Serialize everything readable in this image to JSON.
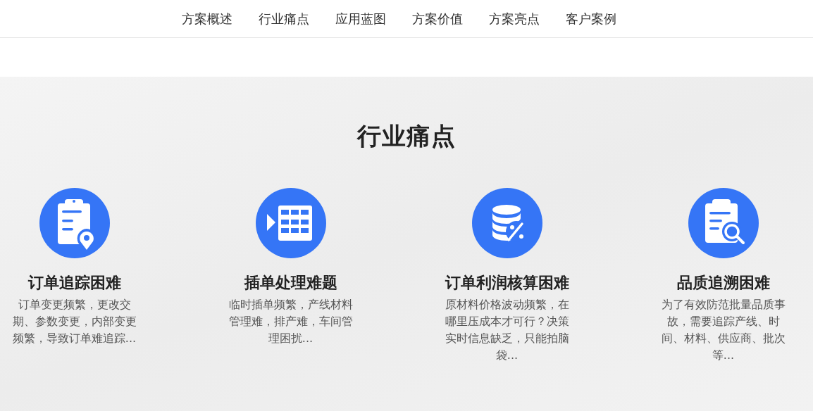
{
  "nav": {
    "items": [
      "方案概述",
      "行业痛点",
      "应用蓝图",
      "方案价值",
      "方案亮点",
      "客户案例"
    ]
  },
  "section": {
    "title": "行业痛点",
    "cards": [
      {
        "title": "订单追踪困难",
        "description": "订单变更频繁，更改交期、参数变更，内部变更频繁，导致订单难追踪..."
      },
      {
        "title": "插单处理难题",
        "description": "临时插单频繁，产线材料管理难，排产难，车间管理困扰..."
      },
      {
        "title": "订单利润核算困难",
        "description": "原材料价格波动频繁，在哪里压成本才可行？决策实时信息缺乏，只能拍脑袋..."
      },
      {
        "title": "品质追溯困难",
        "description": "为了有效防范批量品质事故，需要追踪产线、时间、材料、供应商、批次等..."
      }
    ]
  }
}
